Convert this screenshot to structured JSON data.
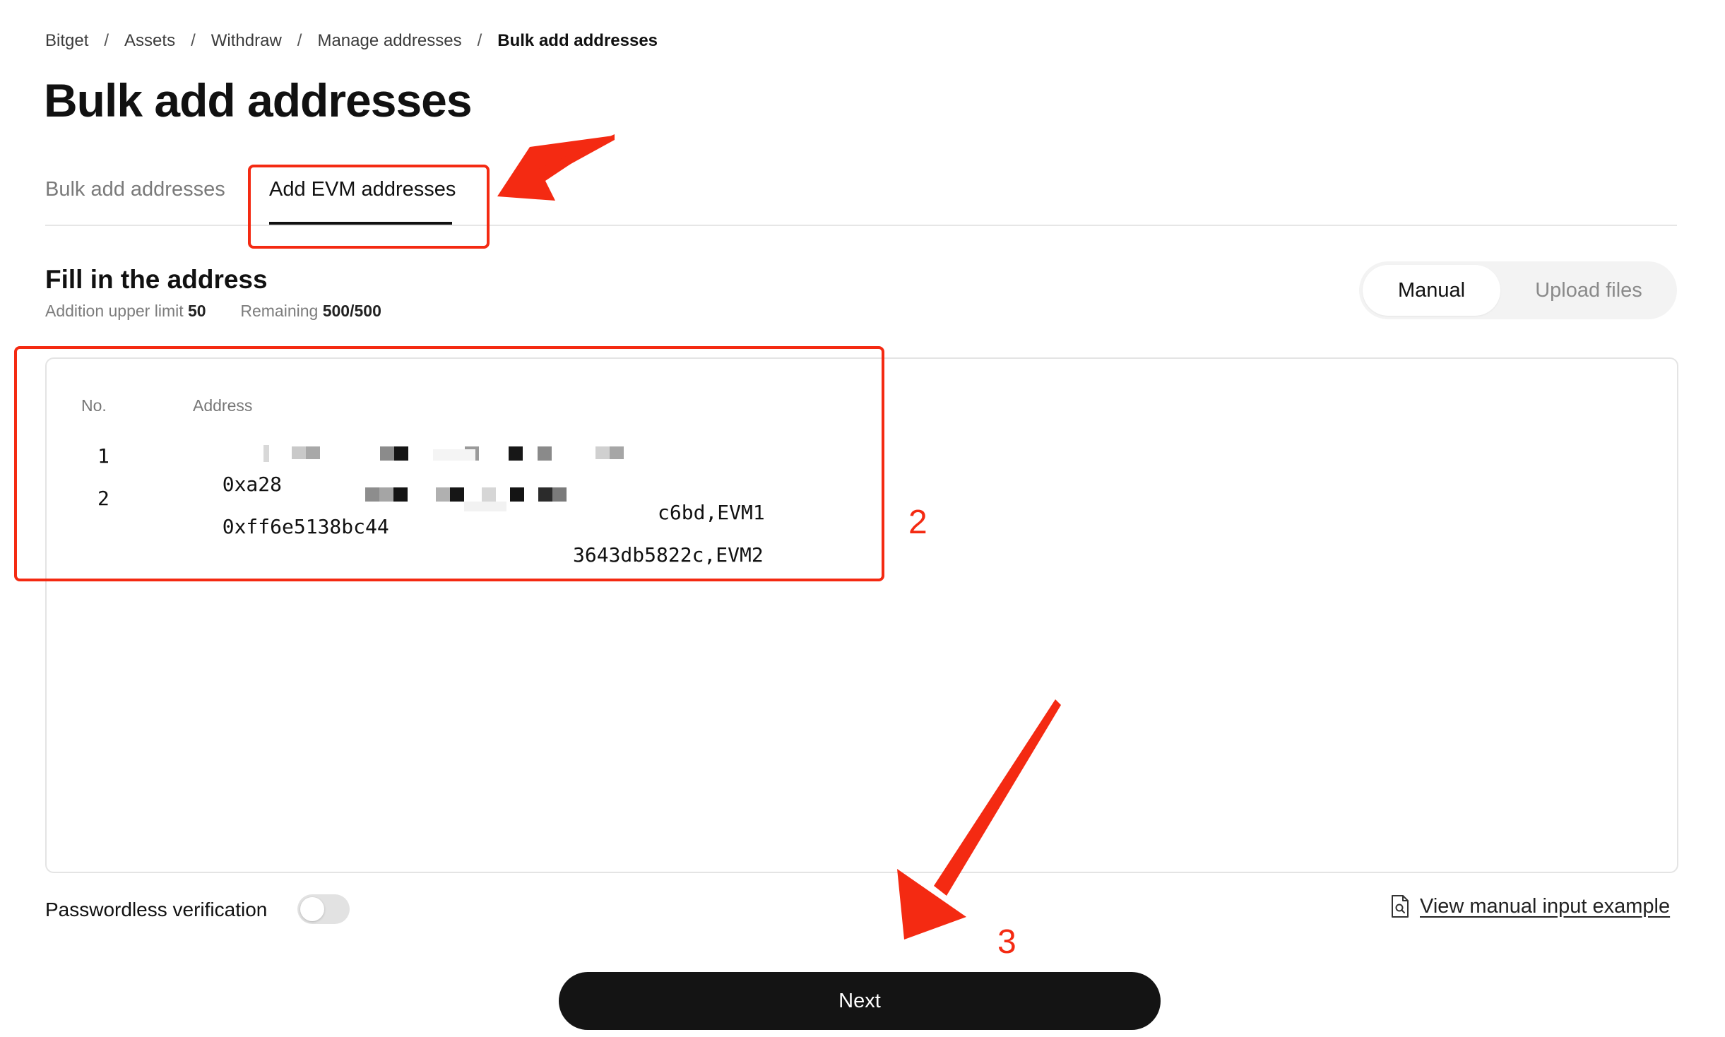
{
  "breadcrumb": {
    "items": [
      "Bitget",
      "Assets",
      "Withdraw",
      "Manage addresses"
    ],
    "current": "Bulk add addresses",
    "separator": "/"
  },
  "page_title": "Bulk add addresses",
  "tabs": [
    {
      "label": "Bulk add addresses",
      "active": false
    },
    {
      "label": "Add EVM addresses",
      "active": true
    }
  ],
  "section": {
    "title": "Fill in the address",
    "limit_label": "Addition upper limit",
    "limit_value": "50",
    "remaining_label": "Remaining",
    "remaining_value": "500/500"
  },
  "input_mode": {
    "manual_label": "Manual",
    "upload_label": "Upload files",
    "selected": "Manual"
  },
  "table": {
    "col_no": "No.",
    "col_address": "Address",
    "rows": [
      {
        "no": "1",
        "address_start": "0xa28",
        "address_end": "c6bd,EVM1"
      },
      {
        "no": "2",
        "address_start": "0xff6e5138bc44",
        "address_end": "3643db5822c,EVM2"
      }
    ]
  },
  "footer": {
    "passwordless_label": "Passwordless verification",
    "passwordless_enabled": false,
    "example_link": "View manual input example",
    "next_label": "Next"
  },
  "annotations": {
    "label_2": "2",
    "label_3": "3",
    "color": "#f42a12"
  },
  "colors": {
    "primary_button": "#141414",
    "border": "#e4e4e4",
    "muted_text": "#7a7a7a"
  }
}
